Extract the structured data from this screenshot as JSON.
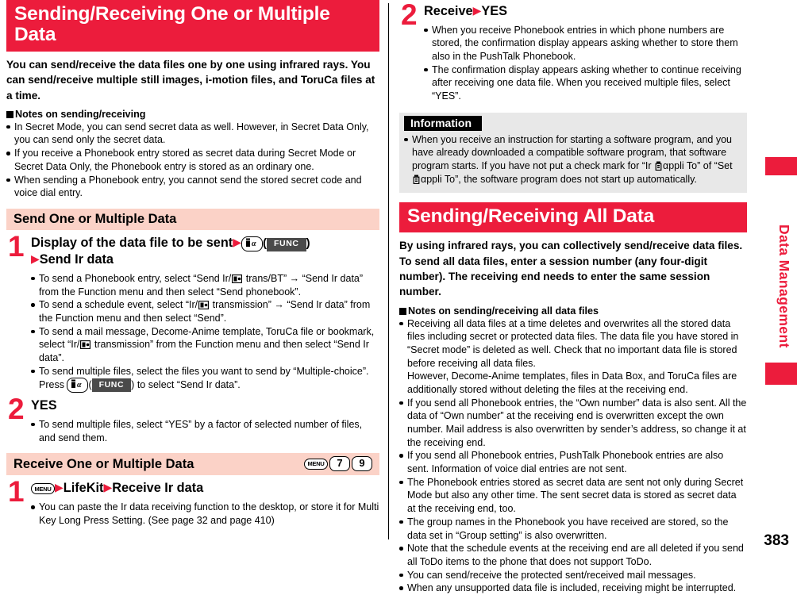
{
  "page": {
    "number": "383",
    "side_tab": "Data Management"
  },
  "left": {
    "banner": "Sending/Receiving One or Multiple Data",
    "lead": "You can send/receive the data files one by one using infrared rays. You can send/receive multiple still images, i-motion files, and ToruCa files at a time.",
    "notes_heading": "Notes on sending/receiving",
    "notes": [
      "In Secret Mode, you can send secret data as well. However, in Secret Data Only, you can send only the secret data.",
      "If you receive a Phonebook entry stored as secret data during Secret Mode or Secret Data Only, the Phonebook entry is stored as an ordinary one.",
      "When sending a Phonebook entry, you cannot send the stored secret code and voice dial entry."
    ],
    "send_section": {
      "title": "Send One or Multiple Data",
      "step1": {
        "number": "1",
        "title_part1": "Display of the data file to be sent",
        "func_label": "FUNC",
        "title_part2": "Send Ir data",
        "bullets": [
          {
            "a": "To send a Phonebook entry, select “Send Ir/",
            "b": " trans/BT” → “Send Ir data” from the Function menu and then select “Send phonebook”."
          },
          {
            "a": "To send a schedule event, select “Ir/",
            "b": " transmission” → “Send Ir data” from the Function menu and then select “Send”."
          },
          {
            "a": "To send a mail message, Decome-Anime template, ToruCa file or bookmark, select “Ir/",
            "b": " transmission” from the Function menu and then select “Send Ir data”."
          }
        ],
        "bullet_multi_a": "To send multiple files, select the files you want to send by “Multiple-choice”. Press ",
        "bullet_multi_func": "FUNC",
        "bullet_multi_b": " to select “Send Ir data”."
      },
      "step2": {
        "number": "2",
        "title": "YES",
        "bullets": [
          "To send multiple files, select “YES” by a factor of selected number of files, and send them."
        ]
      }
    },
    "receive_section": {
      "title": "Receive One or Multiple Data",
      "keys": [
        "MENU",
        "7",
        "9"
      ],
      "step1": {
        "number": "1",
        "menu_key": "MENU",
        "title_part1": "LifeKit",
        "title_part2": "Receive Ir data",
        "bullets": [
          "You can paste the Ir data receiving function to the desktop, or store it for Multi Key Long Press Setting. (See page 32 and page 410)"
        ]
      }
    }
  },
  "right": {
    "step2": {
      "number": "2",
      "title_part1": "Receive",
      "title_part2": "YES",
      "bullets": [
        "When you receive Phonebook entries in which phone numbers are stored, the confirmation display appears asking whether to store them also in the PushTalk Phonebook.",
        "The confirmation display appears asking whether to continue receiving after receiving one data file. When you received multiple files, select “YES”."
      ]
    },
    "information": {
      "label": "Information",
      "bullet_a": "When you receive an instruction for starting a software program, and you have already downloaded a compatible software program, that software program starts. If you have not put a check mark for “Ir ",
      "bullet_b": "αppli To” of “Set ",
      "bullet_c": "αppli To”, the software program does not start up automatically."
    },
    "banner": "Sending/Receiving All Data",
    "lead": "By using infrared rays, you can collectively send/receive data files. To send all data files, enter a session number (any four-digit number). The receiving end needs to enter the same session number.",
    "notes_heading": "Notes on sending/receiving all data files",
    "notes": [
      {
        "text": "Receiving all data files at a time deletes and overwrites all the stored data files including secret or protected data files. The data file you have stored in “Secret mode” is deleted as well. Check that no important data file is stored before receiving all data files.",
        "cont": "However, Decome-Anime templates, files in Data Box, and ToruCa files are additionally stored without deleting the files at the receiving end."
      },
      {
        "text": "If you send all Phonebook entries, the “Own number” data is also sent. All the data of “Own number” at the receiving end is overwritten except the own number. Mail address is also overwritten by sender’s address, so change it at the receiving end."
      },
      {
        "text": "If you send all Phonebook entries, PushTalk Phonebook entries are also sent. Information of voice dial entries are not sent."
      },
      {
        "text": "The Phonebook entries stored as secret data are sent not only during Secret Mode but also any other time. The sent secret data is stored as secret data at the receiving end, too."
      },
      {
        "text": "The group names in the Phonebook you have received are stored, so the data set in “Group setting” is also overwritten."
      },
      {
        "text": "Note that the schedule events at the receiving end are all deleted if you send all ToDo items to the phone that does not support ToDo."
      },
      {
        "text": "You can send/receive the protected sent/received mail messages."
      },
      {
        "text": "When any unsupported data file is included, receiving might be interrupted."
      }
    ]
  },
  "colors": {
    "banner_red": "#ec1c3c",
    "subbar_pink": "#fbd2c7",
    "info_gray": "#e8e8e8",
    "func_dark": "#4a4a4a"
  }
}
